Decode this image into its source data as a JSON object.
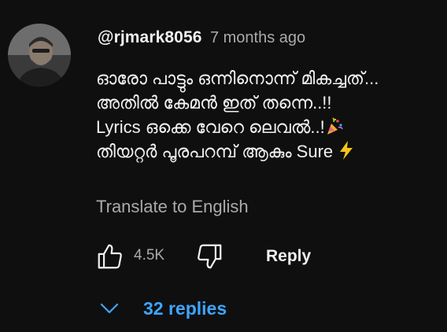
{
  "comment": {
    "author": "@rjmark8056",
    "timestamp": "7 months ago",
    "avatar_icon": "user-avatar-icon",
    "text_lines": [
      "ഓരോ പാട്ടും ഒന്നിനൊന്ന് മികച്ചത്...",
      "അതിൽ കേമൻ ഇത് തന്നെ..!!",
      "Lyrics ഒക്കെ വേറെ ലെവൽ..!",
      "തിയറ്റർ പൂരപറമ്പ് ആകും Sure"
    ],
    "emojis": [
      "party-popper-icon",
      "lightning-bolt-icon"
    ],
    "translate_label": "Translate to English",
    "like_count": "4.5K",
    "reply_label": "Reply",
    "replies_label": "32 replies"
  },
  "colors": {
    "background": "#0f0f0f",
    "primary_text": "#f1f1f1",
    "secondary_text": "#aaaaaa",
    "link_blue": "#3ea6ff",
    "lightning": "#f5c518"
  }
}
